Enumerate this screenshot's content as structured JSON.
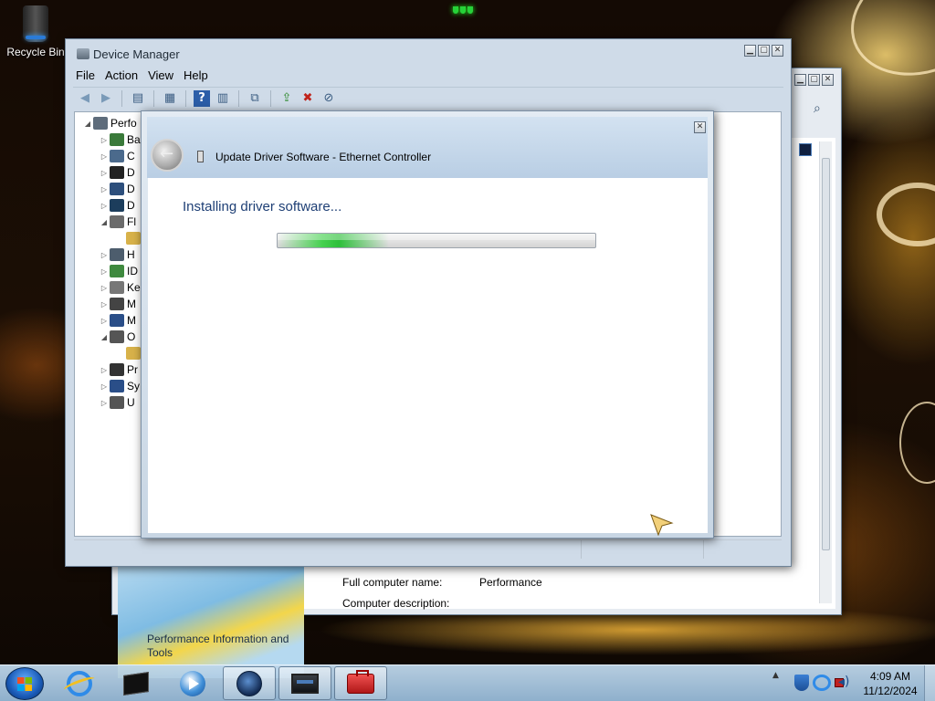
{
  "desktop": {
    "icons": [
      {
        "label": "Recycle Bin",
        "icon": "recycle-bin-icon"
      }
    ]
  },
  "control_panel": {
    "banner_text": "Performance Information and Tools",
    "rows": [
      {
        "label": "Full computer name:",
        "value": "Performance"
      },
      {
        "label": "Computer description:",
        "value": ""
      }
    ]
  },
  "device_manager": {
    "title": "Device Manager",
    "menu": [
      "File",
      "Action",
      "View",
      "Help"
    ],
    "toolbar": [
      "back-icon",
      "forward-icon",
      "show-hide-tree-icon",
      "properties-icon",
      "help-icon",
      "view-icon",
      "scan-hardware-icon",
      "update-driver-icon",
      "uninstall-icon",
      "disable-icon"
    ],
    "tree": [
      {
        "label": "Perfo",
        "expander": "◢",
        "indent": 0
      },
      {
        "label": "Ba",
        "expander": "▷",
        "indent": 1
      },
      {
        "label": "C",
        "expander": "▷",
        "indent": 1
      },
      {
        "label": "D",
        "expander": "▷",
        "indent": 1
      },
      {
        "label": "D",
        "expander": "▷",
        "indent": 1
      },
      {
        "label": "D",
        "expander": "▷",
        "indent": 1
      },
      {
        "label": "Fl",
        "expander": "◢",
        "indent": 1
      },
      {
        "label": "",
        "expander": "",
        "indent": 2
      },
      {
        "label": "H",
        "expander": "▷",
        "indent": 1
      },
      {
        "label": "ID",
        "expander": "▷",
        "indent": 1
      },
      {
        "label": "Ke",
        "expander": "▷",
        "indent": 1
      },
      {
        "label": "M",
        "expander": "▷",
        "indent": 1
      },
      {
        "label": "M",
        "expander": "▷",
        "indent": 1
      },
      {
        "label": "O",
        "expander": "◢",
        "indent": 1
      },
      {
        "label": "",
        "expander": "",
        "indent": 2
      },
      {
        "label": "Pr",
        "expander": "▷",
        "indent": 1
      },
      {
        "label": "Sy",
        "expander": "▷",
        "indent": 1
      },
      {
        "label": "U",
        "expander": "▷",
        "indent": 1
      }
    ]
  },
  "dialog": {
    "title": "Update Driver Software - Ethernet Controller",
    "heading": "Installing driver software...",
    "progress_fraction": 0.35,
    "close_glyph": "✕"
  },
  "taskbar": {
    "pinned": [
      "internet-explorer-icon",
      "command-prompt-icon",
      "media-player-icon",
      "globe-app-icon",
      "device-manager-app-icon",
      "toolbox-app-icon"
    ],
    "clock_time": "4:09 AM",
    "clock_date": "11/12/2024"
  },
  "colors": {
    "dialog_heading": "#1e3f75",
    "progress_green": "#2dbf3a",
    "taskbar": "#a9c7e2"
  }
}
